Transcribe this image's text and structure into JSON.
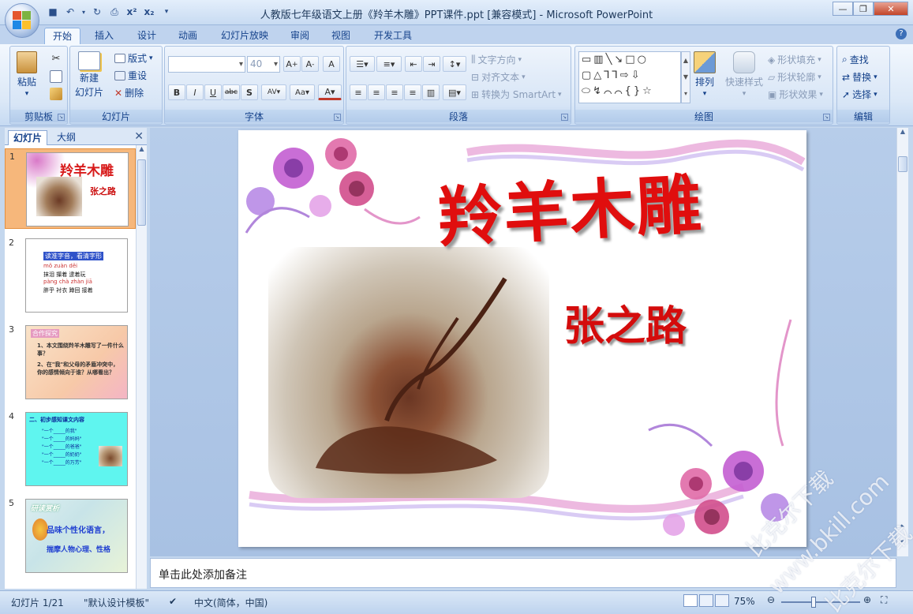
{
  "window": {
    "title": "人教版七年级语文上册《羚羊木雕》PPT课件.ppt [兼容模式] - Microsoft PowerPoint",
    "controls": [
      "minimize",
      "restore",
      "close"
    ]
  },
  "ribbon_tabs": [
    "开始",
    "插入",
    "设计",
    "动画",
    "幻灯片放映",
    "审阅",
    "视图",
    "开发工具"
  ],
  "ribbon": {
    "clipboard": {
      "label": "剪贴板",
      "paste": "粘贴"
    },
    "slides": {
      "label": "幻灯片",
      "new_slide": "新建",
      "new_slide2": "幻灯片",
      "layout": "版式",
      "reset": "重设",
      "delete": "删除"
    },
    "font": {
      "label": "字体",
      "size_placeholder": "40"
    },
    "paragraph": {
      "label": "段落",
      "text_direction": "文字方向",
      "align_text": "对齐文本",
      "smartart": "转换为 SmartArt"
    },
    "drawing": {
      "label": "绘图",
      "arrange": "排列",
      "quick_styles": "快速样式",
      "shape_fill": "形状填充",
      "shape_outline": "形状轮廓",
      "shape_effects": "形状效果"
    },
    "editing": {
      "label": "编辑",
      "find": "查找",
      "replace": "替换",
      "select": "选择"
    }
  },
  "left_pane": {
    "tabs": [
      "幻灯片",
      "大纲"
    ],
    "slides": [
      {
        "num": "1",
        "title": "羚羊木雕",
        "subtitle": "张之路"
      },
      {
        "num": "2",
        "title": "读准字音，看清字形",
        "lines": [
          "mǒ   zuàn   děi",
          "抹泪  攥着  逮着玩",
          "pàng  chà  zhàn  jiā",
          "胖乎  衬衣  蹲回  接着"
        ]
      },
      {
        "num": "3",
        "title": "合作探究",
        "lines": [
          "1、本文围绕羚羊木雕写了一件什么事？",
          "2、在\"我\"和父母的矛盾冲突中，你的感情倾向于谁？从哪看出？"
        ]
      },
      {
        "num": "4",
        "title": "二、初步感知课文内容",
        "lines": [
          "\"一个_____的我\"",
          "\"一个_____的妈妈\"",
          "\"一个_____的爸爸\"",
          "\"一个_____的奶奶\"",
          "\"一个_____的万芳\""
        ]
      },
      {
        "num": "5",
        "title": "研读赏析",
        "lines": [
          "品味个性化语言，",
          "揣摩人物心理、性格"
        ]
      }
    ]
  },
  "slide": {
    "title": "羚羊木雕",
    "author": "张之路"
  },
  "notes_placeholder": "单击此处添加备注",
  "status": {
    "slide_info": "幻灯片 1/21",
    "theme": "\"默认设计模板\"",
    "language": "中文(简体，中国)",
    "zoom": "75%"
  },
  "watermark": [
    "比克尔下载",
    "www.bkill.com",
    "比克尔下载"
  ]
}
